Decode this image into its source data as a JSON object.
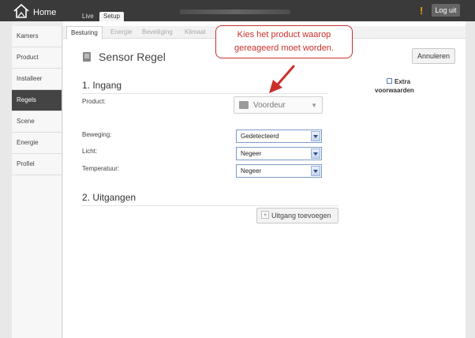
{
  "app": {
    "title": "Home"
  },
  "top_tabs": [
    {
      "label": "Live"
    },
    {
      "label": "Setup"
    }
  ],
  "logout_label": "Log uit",
  "alert_icon": "exclamation-icon",
  "sidebar": {
    "items": [
      {
        "label": "Kamers"
      },
      {
        "label": "Product"
      },
      {
        "label": "Installeer"
      },
      {
        "label": "Regels",
        "active": true
      },
      {
        "label": "Scene"
      },
      {
        "label": "Energie"
      },
      {
        "label": "Profiel"
      }
    ]
  },
  "sub_tabs": [
    {
      "label": "Besturing",
      "active": true
    },
    {
      "label": "Energie"
    },
    {
      "label": "Beveiliging"
    },
    {
      "label": "Klimaat"
    }
  ],
  "page": {
    "title": "Sensor Regel",
    "cancel_label": "Annuleren"
  },
  "section_input": {
    "title": "1. Ingang",
    "product_label": "Product:",
    "product_value": "Voordeur",
    "fields": [
      {
        "label": "Beweging:",
        "value": "Gedetecteerd"
      },
      {
        "label": "Licht:",
        "value": "Negeer"
      },
      {
        "label": "Temperatuur:",
        "value": "Negeer"
      }
    ]
  },
  "section_output": {
    "title": "2. Uitgangen",
    "add_label": "Uitgang toevoegen"
  },
  "extra": {
    "label": "Extra voorwaarden",
    "checked": false
  },
  "callout": {
    "text": "Kies het product waarop gereageerd moet worden."
  },
  "colors": {
    "accent_red": "#c9302c",
    "topbar": "#3a3a3a",
    "active_nav": "#444444"
  }
}
